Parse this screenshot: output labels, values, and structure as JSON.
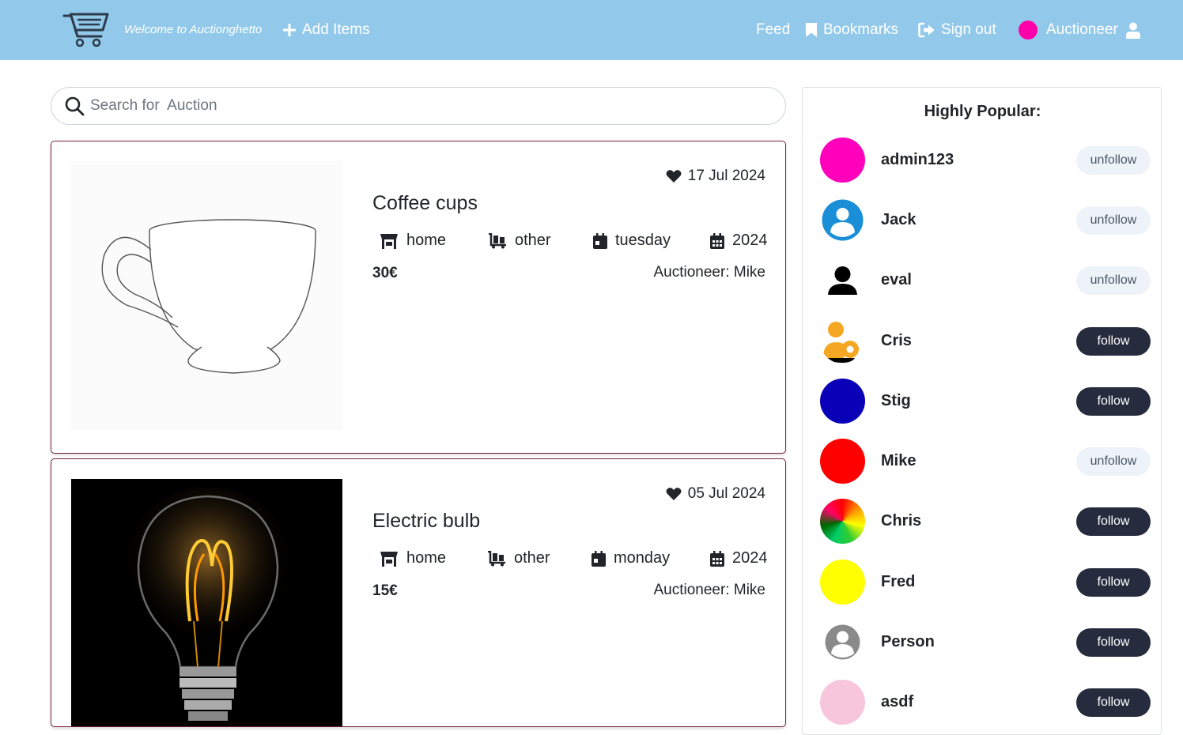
{
  "nav": {
    "welcome": "Welcome to Auctionghetto",
    "add_items": "Add Items",
    "feed": "Feed",
    "bookmarks": "Bookmarks",
    "sign_out": "Sign out",
    "user": "Auctioneer",
    "user_color": "#ff00aa"
  },
  "search": {
    "placeholder": "Search for  Auction"
  },
  "items": [
    {
      "date": "17 Jul 2024",
      "title": "Coffee cups",
      "category": "home",
      "type": "other",
      "day": "tuesday",
      "year": "2024",
      "price": "30€",
      "auctioneer": "Auctioneer: Mike"
    },
    {
      "date": "05 Jul 2024",
      "title": "Electric bulb",
      "category": "home",
      "type": "other",
      "day": "monday",
      "year": "2024",
      "price": "15€",
      "auctioneer": "Auctioneer: Mike"
    }
  ],
  "sidebar": {
    "title": "Highly Popular:",
    "users": [
      {
        "name": "admin123",
        "action": "unfollow",
        "color": "#ff00bb"
      },
      {
        "name": "Jack",
        "action": "unfollow",
        "color": "#1a8fd8"
      },
      {
        "name": "eval",
        "action": "unfollow",
        "color": "#000000"
      },
      {
        "name": "Cris",
        "action": "follow",
        "color": "#f5a623"
      },
      {
        "name": "Stig",
        "action": "follow",
        "color": "#0a00b8"
      },
      {
        "name": "Mike",
        "action": "unfollow",
        "color": "#ff0000"
      },
      {
        "name": "Chris",
        "action": "follow",
        "color": "#33cc33"
      },
      {
        "name": "Fred",
        "action": "follow",
        "color": "#ffff00"
      },
      {
        "name": "Person",
        "action": "follow",
        "color": "#8a8a8a"
      },
      {
        "name": "asdf",
        "action": "follow",
        "color": "#f7c6dc"
      }
    ]
  }
}
